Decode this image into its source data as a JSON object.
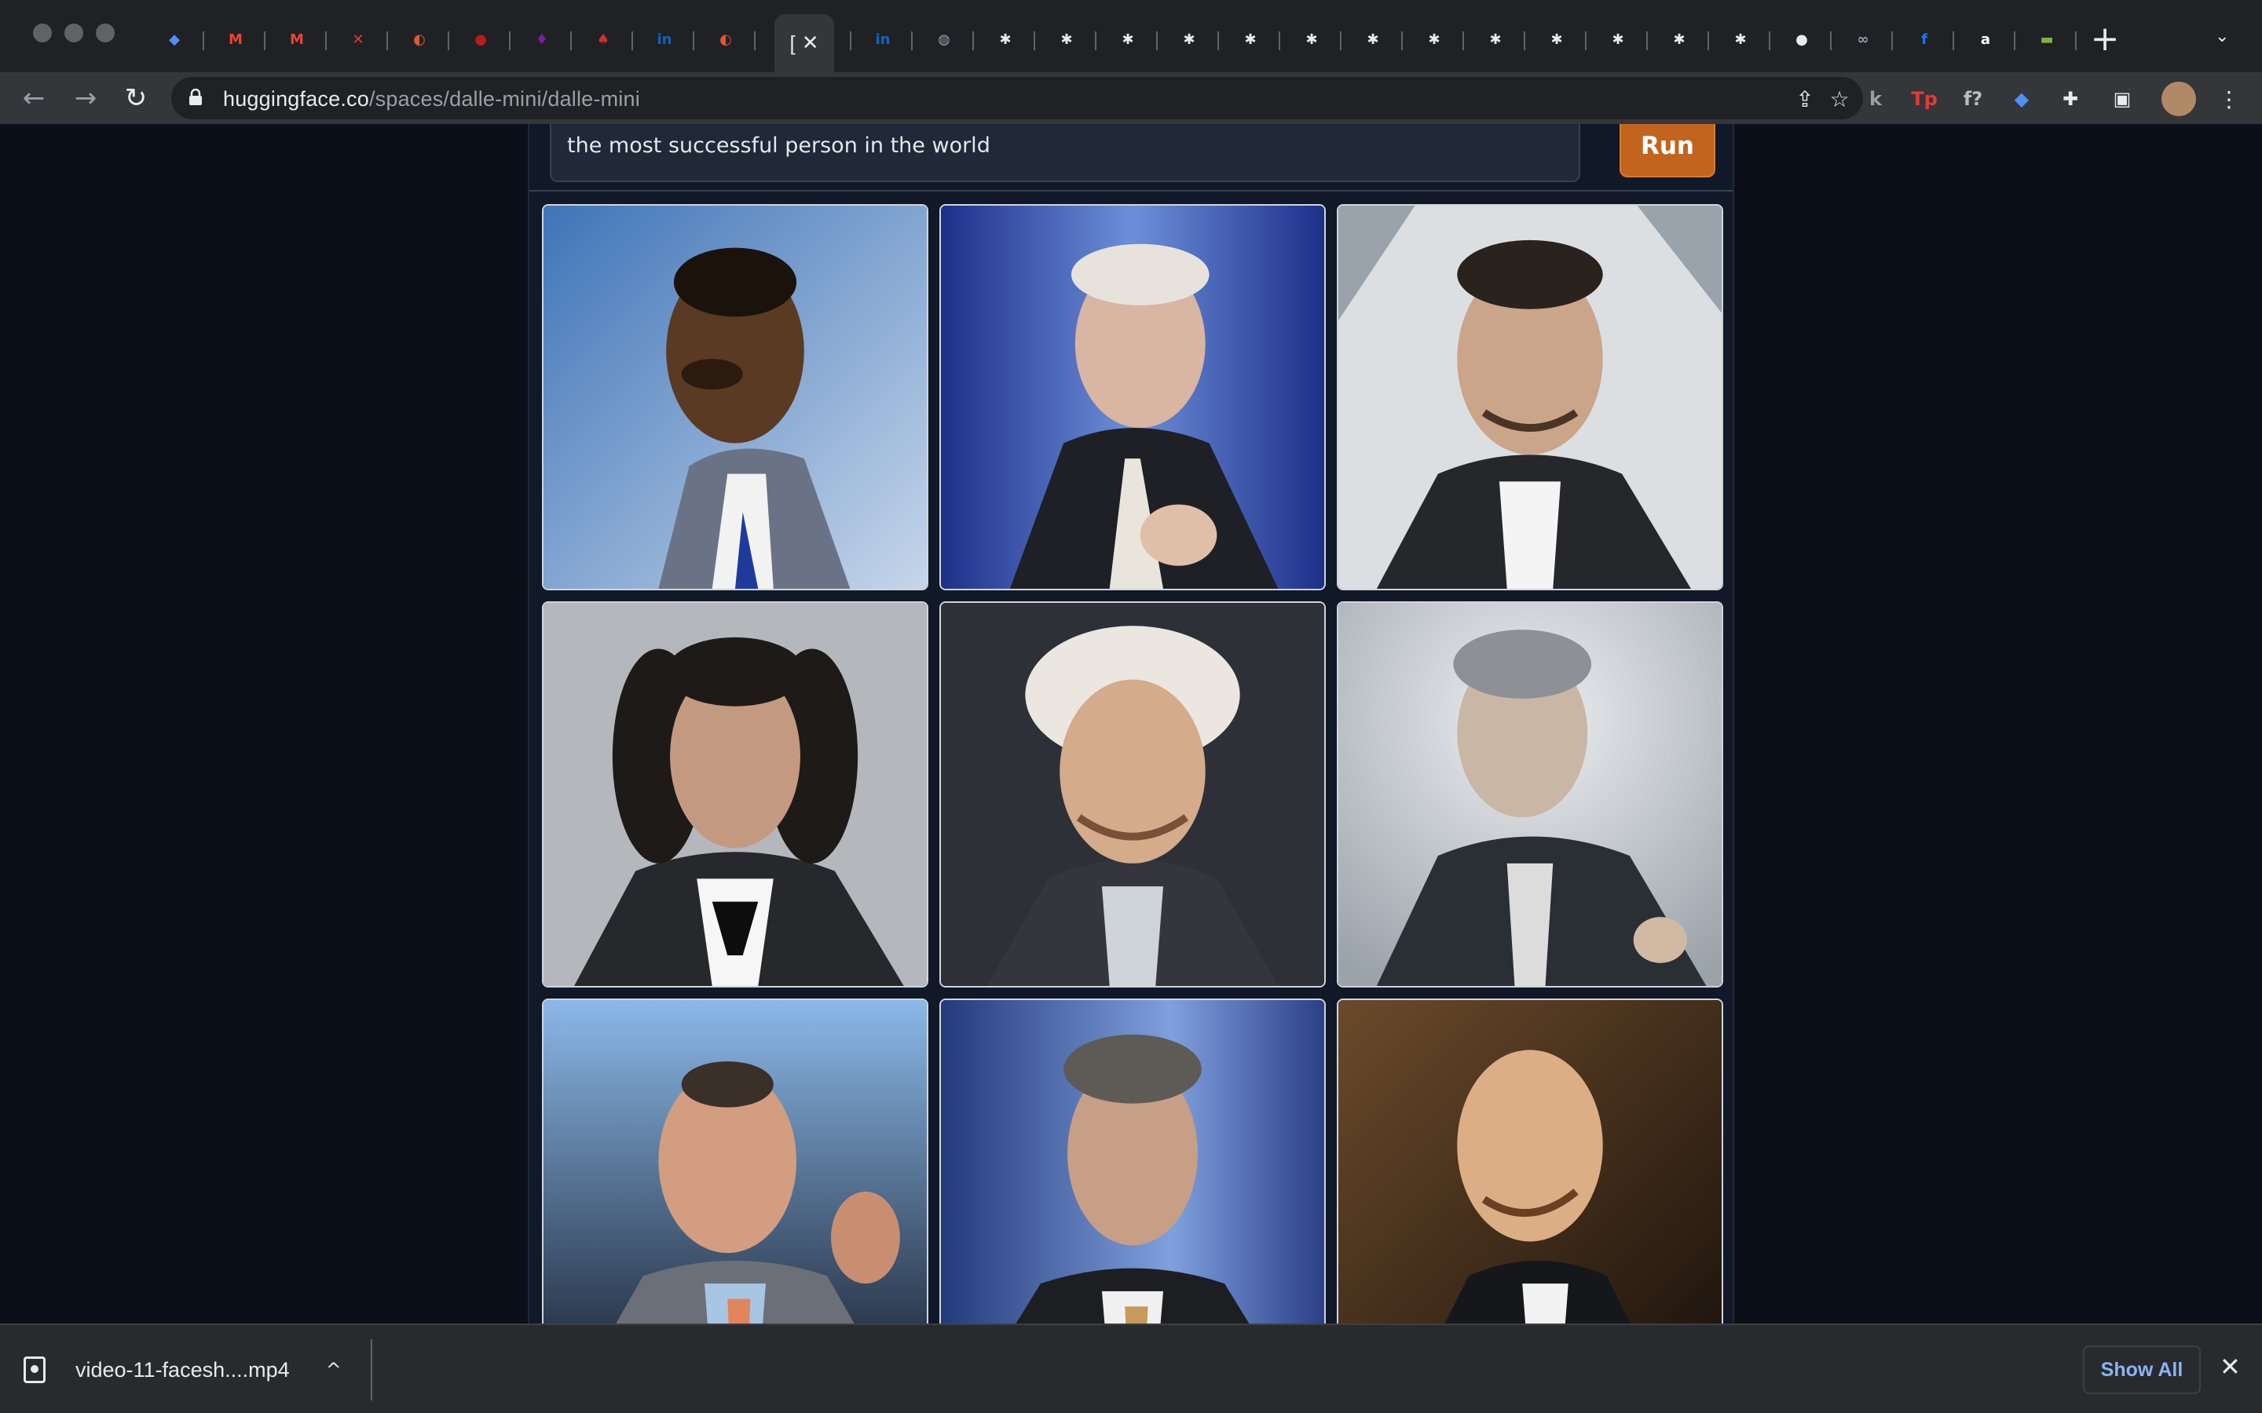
{
  "browser": {
    "tabs": [
      {
        "icon": "gem-icon",
        "glyph": "◆",
        "color": "#4f8ff7"
      },
      {
        "icon": "gmail-icon",
        "glyph": "M",
        "color": "#ea4335"
      },
      {
        "icon": "gmail-icon",
        "glyph": "M",
        "color": "#ea4335"
      },
      {
        "icon": "image-icon",
        "glyph": "✕",
        "color": "#e53935"
      },
      {
        "icon": "duckduckgo-icon",
        "glyph": "◐",
        "color": "#de5833"
      },
      {
        "icon": "red-circle-icon",
        "glyph": "●",
        "color": "#b71c1c"
      },
      {
        "icon": "purple-app-icon",
        "glyph": "♦",
        "color": "#7b1fa2"
      },
      {
        "icon": "red-leaf-icon",
        "glyph": "♠",
        "color": "#d32f2f"
      },
      {
        "icon": "linkedin-icon",
        "glyph": "in",
        "color": "#0a66c2"
      },
      {
        "icon": "duckduckgo-icon",
        "glyph": "◐",
        "color": "#de5833"
      },
      {
        "icon": "linkedin-icon",
        "glyph": "in",
        "color": "#0a66c2"
      },
      {
        "icon": "linkedin-icon",
        "glyph": "in",
        "color": "#0a66c2"
      },
      {
        "icon": "globe-icon",
        "glyph": "◍",
        "color": "#9aa0a6"
      },
      {
        "icon": "gear-icon",
        "glyph": "✱",
        "color": "#e8eaed"
      },
      {
        "icon": "gear-icon",
        "glyph": "✱",
        "color": "#e8eaed"
      },
      {
        "icon": "gear-icon",
        "glyph": "✱",
        "color": "#e8eaed"
      },
      {
        "icon": "gear-icon",
        "glyph": "✱",
        "color": "#e8eaed"
      },
      {
        "icon": "gear-icon",
        "glyph": "✱",
        "color": "#e8eaed"
      },
      {
        "icon": "gear-icon",
        "glyph": "✱",
        "color": "#e8eaed"
      },
      {
        "icon": "gear-icon",
        "glyph": "✱",
        "color": "#e8eaed"
      },
      {
        "icon": "gear-icon",
        "glyph": "✱",
        "color": "#e8eaed"
      },
      {
        "icon": "gear-icon",
        "glyph": "✱",
        "color": "#e8eaed"
      },
      {
        "icon": "gear-icon",
        "glyph": "✱",
        "color": "#e8eaed"
      },
      {
        "icon": "gear-icon",
        "glyph": "✱",
        "color": "#e8eaed"
      },
      {
        "icon": "gear-icon",
        "glyph": "✱",
        "color": "#e8eaed"
      },
      {
        "icon": "gear-icon",
        "glyph": "✱",
        "color": "#e8eaed"
      },
      {
        "icon": "github-icon",
        "glyph": "●",
        "color": "#e8eaed"
      },
      {
        "icon": "infinity-icon",
        "glyph": "∞",
        "color": "#9aa0a6"
      },
      {
        "icon": "facebook-icon",
        "glyph": "f",
        "color": "#1877f2"
      },
      {
        "icon": "amazon-icon",
        "glyph": "a",
        "color": "#ffffff"
      },
      {
        "icon": "green-card-icon",
        "glyph": "▬",
        "color": "#7cb342"
      }
    ],
    "active_tab_short": "[",
    "active_tab_close": "✕",
    "new_tab": "+",
    "tab_search": "⌄",
    "url_host": "huggingface.co",
    "url_path": "/spaces/dalle-mini/dalle-mini"
  },
  "toolbar": {
    "back": "←",
    "forward": "→",
    "reload": "↻",
    "share": "⇪",
    "star": "☆",
    "menu": "⋮"
  },
  "extensions": [
    {
      "icon": "k-extension-icon",
      "glyph": "k",
      "color": "#9e9e9e"
    },
    {
      "icon": "tp-extension-icon",
      "glyph": "Tp",
      "color": "#e53935"
    },
    {
      "icon": "formula-extension-icon",
      "glyph": "f?",
      "color": "#bdbdbd"
    },
    {
      "icon": "gem-extension-icon",
      "glyph": "◆",
      "color": "#4f8ff7"
    },
    {
      "icon": "puzzle-icon",
      "glyph": "✚",
      "color": "#e8eaed"
    },
    {
      "icon": "sidepanel-icon",
      "glyph": "▣",
      "color": "#e8eaed"
    }
  ],
  "app": {
    "prompt_value": "the most successful person in the world",
    "run_label": "Run"
  },
  "download": {
    "filename": "video-11-facesh....mp4",
    "chevron": "^",
    "show_all": "Show All",
    "close": "✕"
  },
  "colors": {
    "accent_run": "#c2641e",
    "page_bg": "#0b0f19",
    "panel_bg": "#111827"
  }
}
